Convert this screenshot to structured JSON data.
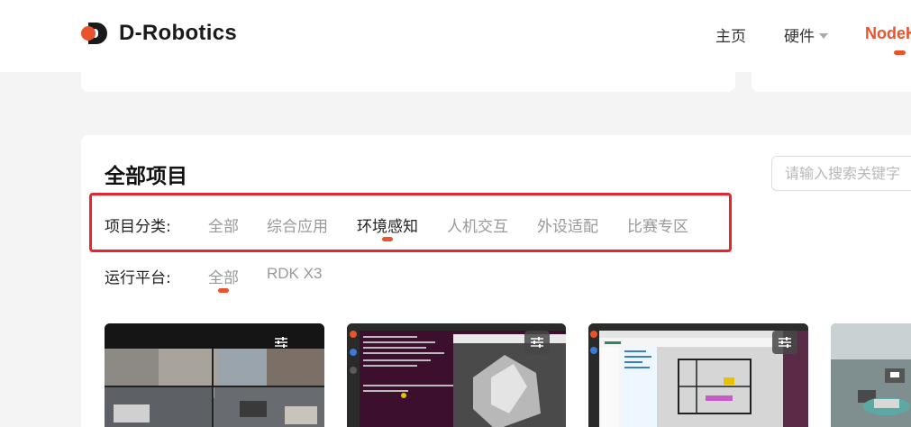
{
  "brand": {
    "name": "D-Robotics",
    "accent": "#e8542b"
  },
  "nav": {
    "home": "主页",
    "hardware": "硬件",
    "nodehub": "NodeHub"
  },
  "section": {
    "title": "全部项目",
    "search_placeholder": "请输入搜索关键字"
  },
  "filters": {
    "category_label": "项目分类:",
    "category_options": [
      "全部",
      "综合应用",
      "环境感知",
      "人机交互",
      "外设适配",
      "比赛专区"
    ],
    "category_selected": "环境感知",
    "platform_label": "运行平台:",
    "platform_options": [
      "全部",
      "RDK X3"
    ],
    "platform_selected": "全部"
  },
  "thumbnails": [
    {
      "name": "street-scene-multi-camera"
    },
    {
      "name": "terminal-and-map"
    },
    {
      "name": "ide-and-slam-map"
    },
    {
      "name": "robot-on-floor"
    }
  ]
}
